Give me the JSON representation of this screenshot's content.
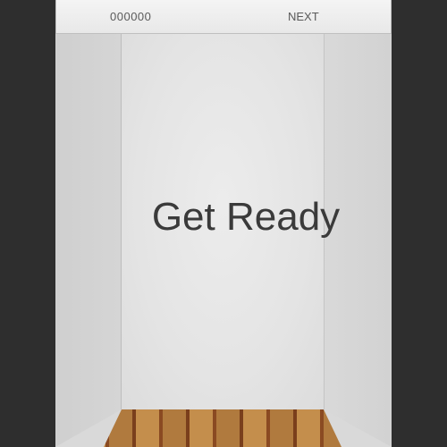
{
  "hud": {
    "score": "000000",
    "next_label": "NEXT"
  },
  "overlay": {
    "message": "Get Ready"
  },
  "colors": {
    "background": "#2e2e2e",
    "wall": "#e4e4e4",
    "text": "#3a3a3a",
    "hud_text": "#5a5a5a",
    "floor_wood": "#b07a3e"
  }
}
